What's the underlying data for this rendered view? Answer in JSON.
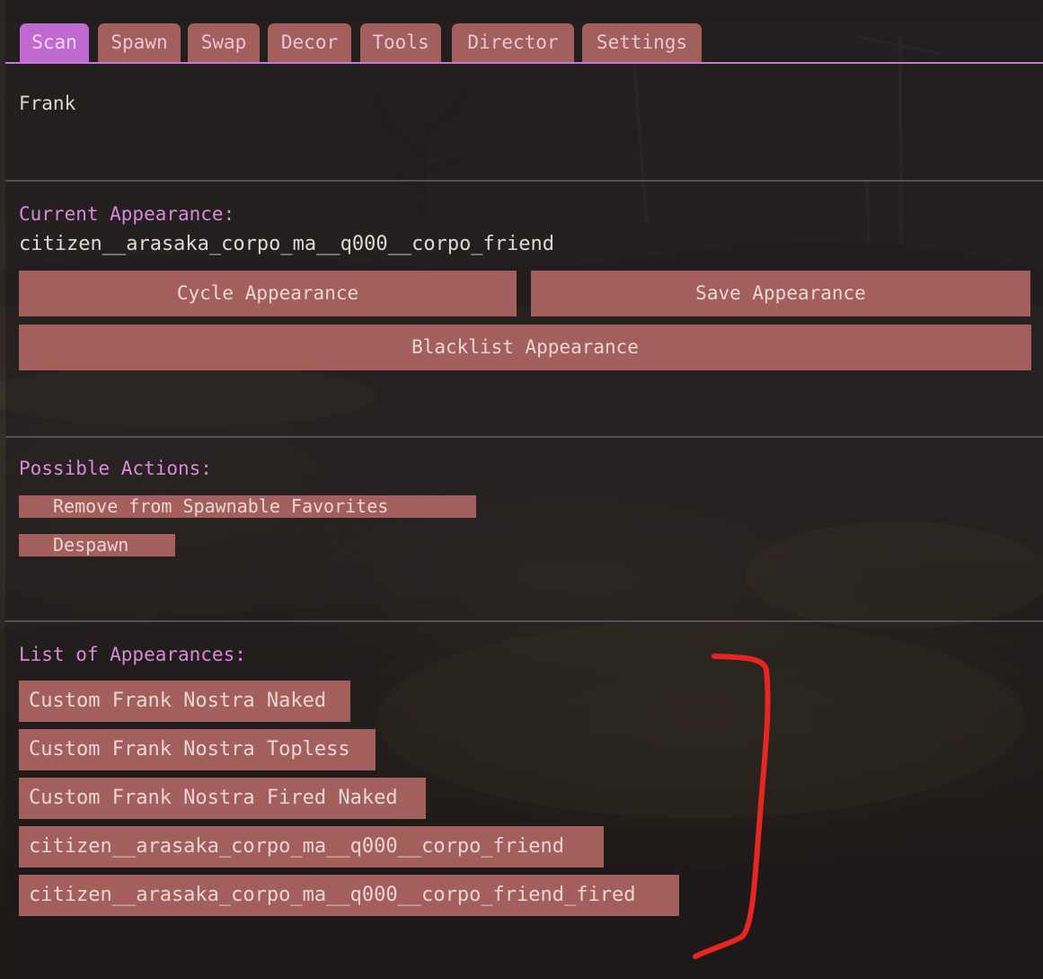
{
  "tabs": [
    {
      "label": "Scan",
      "active": true
    },
    {
      "label": "Spawn",
      "active": false
    },
    {
      "label": "Swap",
      "active": false
    },
    {
      "label": "Decor",
      "active": false
    },
    {
      "label": "Tools",
      "active": false
    },
    {
      "label": "Director",
      "active": false
    },
    {
      "label": "Settings",
      "active": false
    }
  ],
  "target_name": "Frank",
  "appearance": {
    "heading": "Current Appearance:",
    "current": "citizen__arasaka_corpo_ma__q000__corpo_friend",
    "cycle_label": "Cycle Appearance",
    "save_label": "Save Appearance",
    "blacklist_label": "Blacklist Appearance"
  },
  "actions": {
    "heading": "Possible Actions:",
    "items": [
      "Remove from Spawnable Favorites",
      "Despawn"
    ]
  },
  "appearance_list": {
    "heading": "List of Appearances:",
    "items": [
      "Custom Frank Nostra Naked",
      "Custom Frank Nostra Topless",
      "Custom Frank Nostra Fired Naked",
      "citizen__arasaka_corpo_ma__q000__corpo_friend",
      "citizen__arasaka_corpo_ma__q000__corpo_friend_fired"
    ]
  },
  "colors": {
    "accent": "#c06ad0",
    "button": "#a35f5c",
    "heading": "#d88ad8",
    "annotation_stroke": "#e8261f"
  }
}
